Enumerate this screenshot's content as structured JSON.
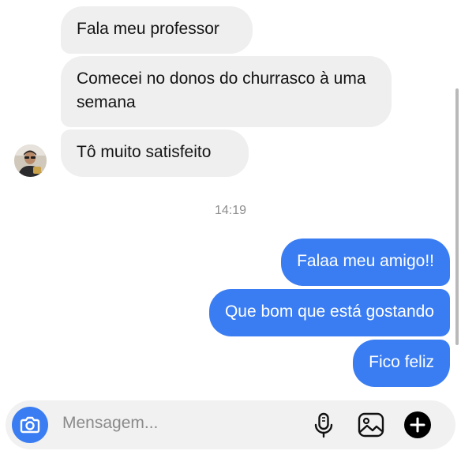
{
  "messages_in": [
    "Fala meu professor",
    "Comecei no donos do churrasco à uma semana",
    "Tô muito satisfeito"
  ],
  "timestamp": "14:19",
  "messages_out": [
    "Falaa meu amigo!!",
    "Que bom que está gostando",
    "Fico feliz"
  ],
  "composer": {
    "placeholder": "Mensagem..."
  },
  "colors": {
    "incoming_bubble": "#efefef",
    "outgoing_bubble": "#3a7df2",
    "accent": "#3a7df2"
  },
  "icons": [
    "camera-icon",
    "microphone-icon",
    "gallery-icon",
    "plus-icon"
  ]
}
